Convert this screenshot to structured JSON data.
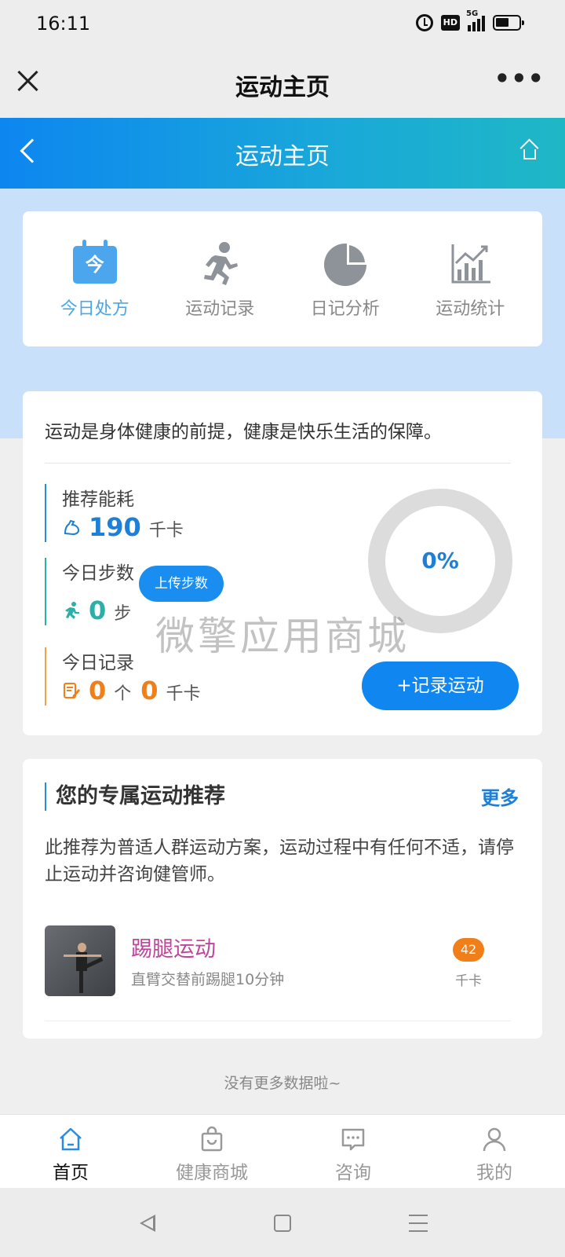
{
  "status_bar": {
    "time": "16:11",
    "hd_label": "HD",
    "network_label": "5G"
  },
  "wechat_bar": {
    "title": "运动主页",
    "more_label": "•••"
  },
  "app_header": {
    "title": "运动主页"
  },
  "nav": [
    {
      "label": "今日处方",
      "icon": "calendar-today-icon",
      "glyph": "今",
      "active": true
    },
    {
      "label": "运动记录",
      "icon": "running-person-icon",
      "glyph": "🏃",
      "active": false
    },
    {
      "label": "日记分析",
      "icon": "pie-chart-icon",
      "glyph": "",
      "active": false
    },
    {
      "label": "运动统计",
      "icon": "line-chart-icon",
      "glyph": "",
      "active": false
    }
  ],
  "summary": {
    "slogan": "运动是身体健康的前提，健康是快乐生活的保障。",
    "recommended": {
      "label": "推荐能耗",
      "value": "190",
      "unit": "千卡"
    },
    "steps": {
      "label": "今日步数",
      "value": "0",
      "unit": "步",
      "upload_label": "上传步数"
    },
    "today_record": {
      "label": "今日记录",
      "count": "0",
      "count_unit": "个",
      "kcal": "0",
      "kcal_unit": "千卡"
    },
    "progress_text": "0%",
    "progress_fraction": 0,
    "record_button": "+记录运动"
  },
  "watermark": "微擎应用商城",
  "recommend": {
    "title": "您的专属运动推荐",
    "more": "更多",
    "description": "此推荐为普适人群运动方案，运动过程中有任何不适，请停止运动并咨询健管师。",
    "items": [
      {
        "name": "踢腿运动",
        "desc": "直臂交替前踢腿10分钟",
        "kcal": "42",
        "unit": "千卡"
      }
    ]
  },
  "no_more": "没有更多数据啦~",
  "tabbar": [
    {
      "label": "首页",
      "icon": "home-icon",
      "active": true
    },
    {
      "label": "健康商城",
      "icon": "shopping-bag-icon",
      "active": false
    },
    {
      "label": "咨询",
      "icon": "chat-bubble-icon",
      "active": false
    },
    {
      "label": "我的",
      "icon": "user-icon",
      "active": false
    }
  ],
  "colors": {
    "header_gradient_start": "#0d86f0",
    "header_gradient_end": "#1fb7c6",
    "accent_blue": "#1d7fd6",
    "teal": "#2bb0a8",
    "orange": "#f07f1a",
    "pink": "#c2449a"
  }
}
